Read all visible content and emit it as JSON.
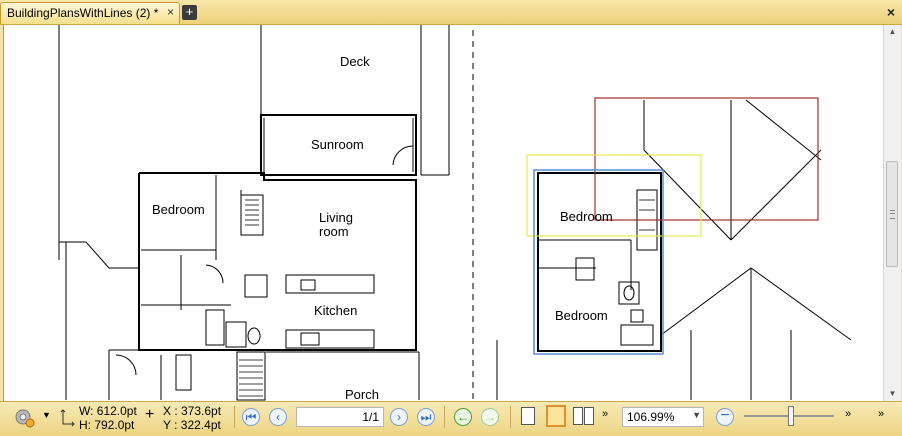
{
  "tab": {
    "title": "BuildingPlansWithLines (2) *",
    "close": "×",
    "add": "+"
  },
  "window": {
    "close": "×"
  },
  "plan_labels": {
    "deck": "Deck",
    "sunroom": "Sunroom",
    "bedroom_left": "Bedroom",
    "living_line1": "Living",
    "living_line2": "room",
    "kitchen": "Kitchen",
    "porch": "Porch",
    "bedroom_upper": "Bedroom",
    "bedroom_lower": "Bedroom"
  },
  "status": {
    "width": "W: 612.0pt",
    "height": "H: 792.0pt",
    "x": "X : 373.6pt",
    "y": "Y : 322.4pt",
    "page": "1/1",
    "zoom": "106.99%"
  },
  "colors": {
    "accent": "#ecd27a",
    "markup_red": "#a0302a",
    "markup_yellow": "#e8e84a",
    "selection_blue": "#5a8ed0"
  },
  "icons": [
    "settings-gear-icon",
    "first-page-icon",
    "prev-page-icon",
    "next-page-icon",
    "last-page-icon",
    "back-icon",
    "forward-icon",
    "single-page-icon",
    "continuous-page-icon",
    "facing-pages-icon",
    "zoom-out-icon"
  ]
}
